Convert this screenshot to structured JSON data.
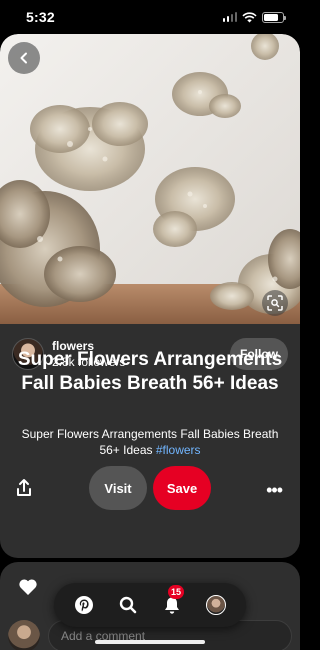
{
  "status_bar": {
    "time": "5:32"
  },
  "pin": {
    "creator": {
      "name": "flowers",
      "followers": "2.8k followers"
    },
    "follow_label": "Follow",
    "title": "Super Flowers Arrangements Fall Babies Breath 56+ Ideas",
    "description": "Super Flowers Arrangements Fall Babies Breath 56+ Ideas",
    "hashtag": "#flowers",
    "visit_label": "Visit",
    "save_label": "Save",
    "more_label": "•••"
  },
  "comments": {
    "placeholder": "Add a comment"
  },
  "nav": {
    "notification_count": "15",
    "items": [
      "pinterest-logo-icon",
      "search-icon",
      "bell-icon",
      "profile-avatar"
    ]
  },
  "colors": {
    "accent": "#e60023",
    "hashtag": "#72b6ff",
    "card": "#2f2f2f",
    "background": "#000000"
  }
}
